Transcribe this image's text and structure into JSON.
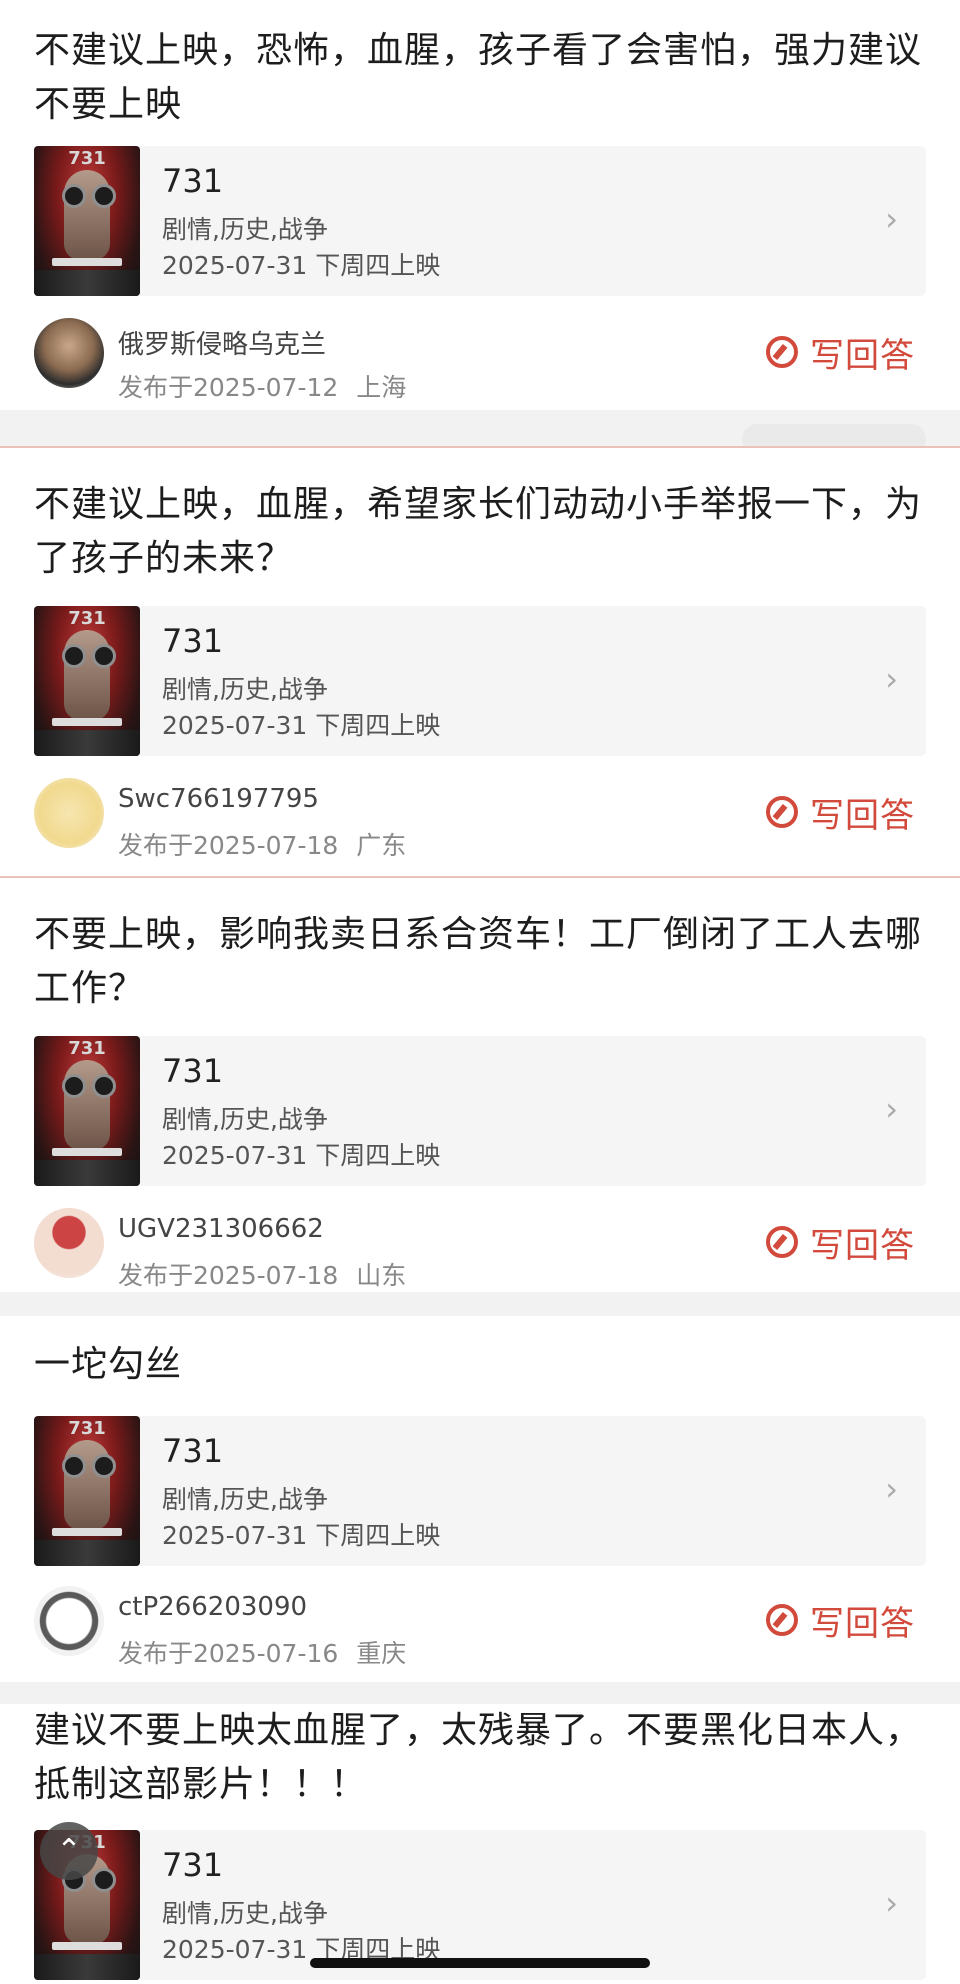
{
  "posts": [
    {
      "title": "不建议上映，恐怖，血腥，孩子看了会害怕，强力建议不要上映",
      "movie": {
        "title": "731",
        "genre": "剧情,历史,战争",
        "date": "2025-07-31 下周四上映"
      },
      "user": {
        "name": "俄罗斯侵略乌克兰",
        "published": "发布于2025-07-12",
        "location": "上海",
        "avatar": "person-photo"
      },
      "action": "写回答"
    },
    {
      "title": "不建议上映，血腥，希望家长们动动小手举报一下，为了孩子的未来？",
      "movie": {
        "title": "731",
        "genre": "剧情,历史,战争",
        "date": "2025-07-31 下周四上映"
      },
      "user": {
        "name": "Swc766197795",
        "published": "发布于2025-07-18",
        "location": "广东",
        "avatar": "cartoon-face"
      },
      "action": "写回答"
    },
    {
      "title": "不要上映，影响我卖日系合资车！工厂倒闭了工人去哪工作？",
      "movie": {
        "title": "731",
        "genre": "剧情,历史,战争",
        "date": "2025-07-31 下周四上映"
      },
      "user": {
        "name": "UGV231306662",
        "published": "发布于2025-07-18",
        "location": "山东",
        "avatar": "cartoon-face"
      },
      "action": "写回答"
    },
    {
      "title": "一坨勾丝",
      "movie": {
        "title": "731",
        "genre": "剧情,历史,战争",
        "date": "2025-07-31 下周四上映"
      },
      "user": {
        "name": "ctP266203090",
        "published": "发布于2025-07-16",
        "location": "重庆",
        "avatar": "cartoon-face"
      },
      "action": "写回答"
    },
    {
      "title": "建议不要上映太血腥了，太残暴了。不要黑化日本人，抵制这部影片！！！",
      "movie": {
        "title": "731",
        "genre": "剧情,历史,战争",
        "date": "2025-07-31 下周四上映"
      }
    }
  ],
  "icons": {
    "chevron": "chevron-right-icon",
    "answer": "edit-circle-icon",
    "back_to_top": "chevron-up-icon"
  },
  "colors": {
    "accent": "#d24a3c",
    "card_bg": "#f5f5f5",
    "divider": "#e9c3ba"
  }
}
